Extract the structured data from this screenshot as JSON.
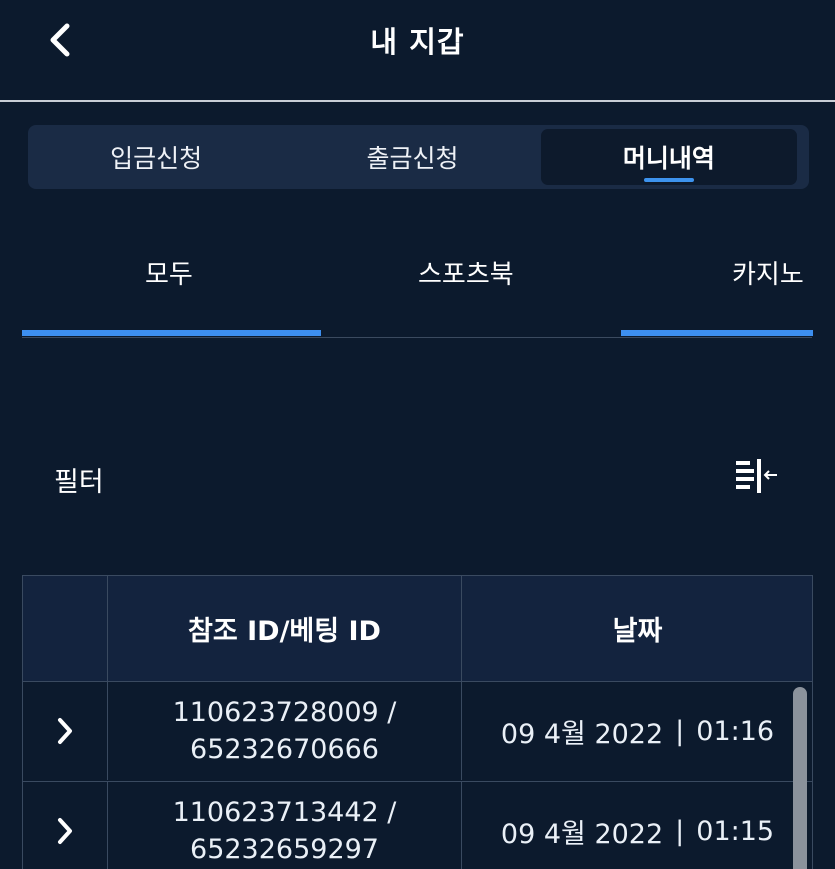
{
  "header": {
    "title": "내 지갑",
    "back_icon": "chevron-left-icon"
  },
  "wallet_tabs": [
    {
      "label": "입금신청",
      "active": false
    },
    {
      "label": "출금신청",
      "active": false
    },
    {
      "label": "머니내역",
      "active": true
    }
  ],
  "category_tabs": [
    {
      "label": "모두",
      "active": true
    },
    {
      "label": "스포츠북",
      "active": false
    },
    {
      "label": "카지노",
      "active": false
    }
  ],
  "filter": {
    "label": "필터",
    "icon": "filter-sort-icon"
  },
  "table": {
    "headers": [
      "",
      "참조 ID/베팅 ID",
      "날짜"
    ],
    "rows": [
      {
        "ref_id": "110623728009 /",
        "bet_id": "65232670666",
        "date": "09 4월 2022",
        "time": "01:16"
      },
      {
        "ref_id": "110623713442 /",
        "bet_id": "65232659297",
        "date": "09 4월 2022",
        "time": "01:15"
      }
    ],
    "date_separator": "|"
  },
  "colors": {
    "background": "#0c1a2d",
    "accent": "#3d8ff0",
    "table_header": "#13233e",
    "border": "#3a4a60"
  }
}
